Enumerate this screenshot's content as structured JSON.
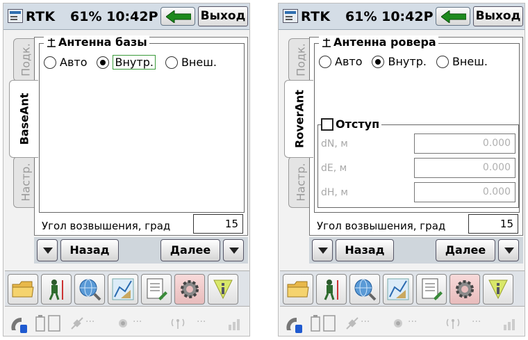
{
  "screens": [
    {
      "title": "RTK",
      "status": "61% 10:42P",
      "exit_label": "Выход",
      "tabs": [
        "Подк.",
        "BaseAnt",
        "Настр."
      ],
      "group_title": "Антенна базы",
      "options": [
        "Авто",
        "Внутр.",
        "Внеш."
      ],
      "selected_option": "Внутр.",
      "elevation_label": "Угол возвышения, град",
      "elevation_value": "15",
      "back_label": "Назад",
      "next_label": "Далее"
    },
    {
      "title": "RTK",
      "status": "61% 10:42P",
      "exit_label": "Выход",
      "tabs": [
        "Подк.",
        "RoverAnt",
        "Настр."
      ],
      "group_title": "Антенна ровера",
      "options": [
        "Авто",
        "Внутр.",
        "Внеш."
      ],
      "selected_option": "Внутр.",
      "offset_title": "Отступ",
      "offset_checked": false,
      "offset_fields": [
        {
          "label": "dN, м",
          "value": "0.000"
        },
        {
          "label": "dE, м",
          "value": "0.000"
        },
        {
          "label": "dH, м",
          "value": "0.000"
        }
      ],
      "elevation_label": "Угол возвышения, град",
      "elevation_value": "15",
      "back_label": "Назад",
      "next_label": "Далее"
    }
  ],
  "toolbar_icons": [
    "folder-icon",
    "surveyor-icon",
    "globe-search-icon",
    "survey-map-icon",
    "notepad-icon",
    "gear-icon",
    "info-icon"
  ],
  "status_icons": [
    "gnss-receiver-icon",
    "battery-icon",
    "memory-card-icon",
    "satellite-icon",
    "radio-icon",
    "antenna-signal-icon",
    "signal-bars-icon"
  ],
  "status_placeholder": "...",
  "colors": {
    "selection_focus": "#3a9a3a",
    "back_arrow": "#1d8a1d",
    "gear_button": "#f0c8c8"
  }
}
